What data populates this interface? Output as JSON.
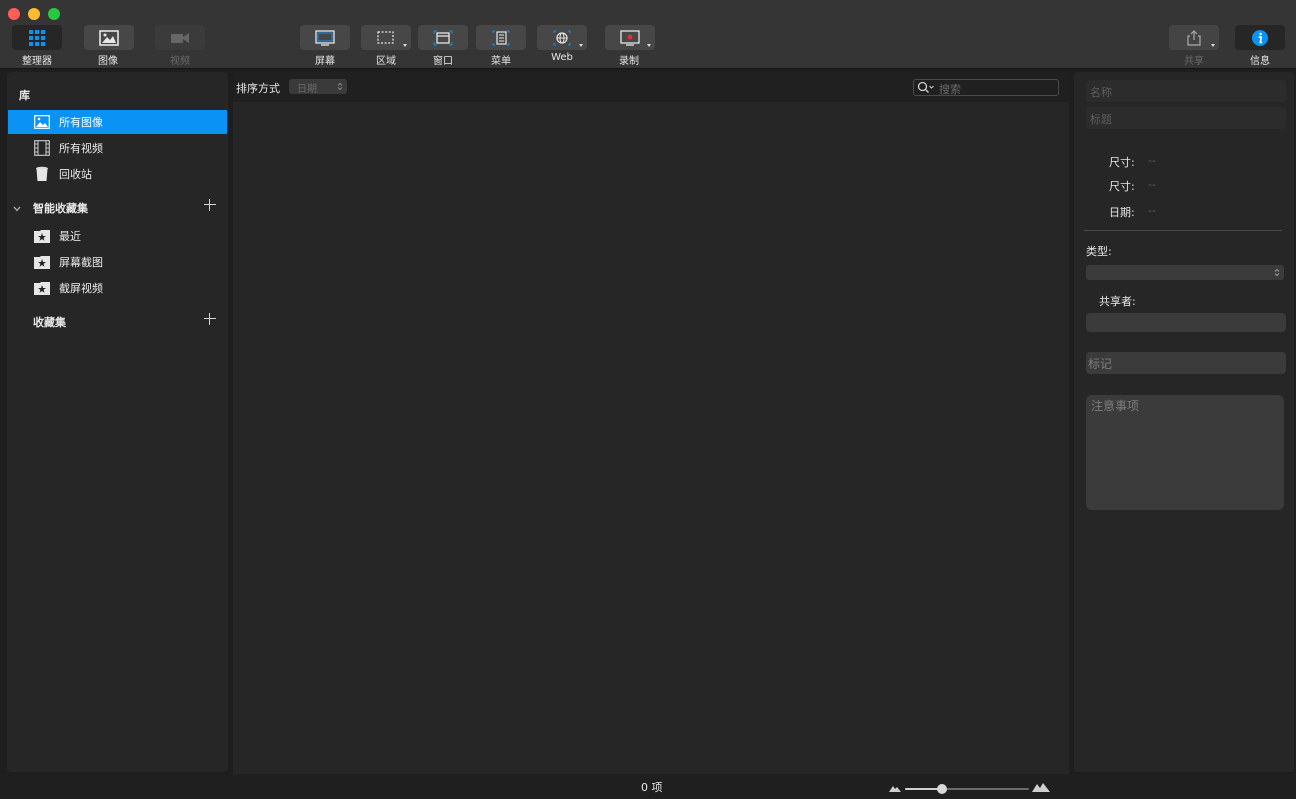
{
  "toolbar": {
    "left_buttons": [
      {
        "id": "organizer",
        "label": "整理器",
        "state": "active"
      },
      {
        "id": "images",
        "label": "图像",
        "state": "normal"
      },
      {
        "id": "video",
        "label": "视频",
        "state": "disabled"
      }
    ],
    "capture_buttons": [
      {
        "id": "screen",
        "label": "屏幕"
      },
      {
        "id": "region",
        "label": "区域"
      },
      {
        "id": "window",
        "label": "窗口"
      },
      {
        "id": "menu",
        "label": "菜单"
      },
      {
        "id": "web",
        "label": "Web"
      },
      {
        "id": "record",
        "label": "录制"
      }
    ],
    "share_label": "共享",
    "info_label": "信息"
  },
  "sidebar": {
    "library_header": "库",
    "library_items": [
      {
        "label": "所有图像",
        "icon": "image-icon",
        "selected": true
      },
      {
        "label": "所有视频",
        "icon": "film-icon",
        "selected": false
      },
      {
        "label": "回收站",
        "icon": "trash-icon",
        "selected": false
      }
    ],
    "smart_header": "智能收藏集",
    "smart_items": [
      {
        "label": "最近",
        "icon": "star-folder-icon"
      },
      {
        "label": "屏幕截图",
        "icon": "star-folder-icon"
      },
      {
        "label": "截屏视频",
        "icon": "star-folder-icon"
      }
    ],
    "collections_header": "收藏集"
  },
  "main": {
    "sort_label": "排序方式",
    "sort_value": "日期",
    "search_placeholder": "搜索"
  },
  "info_panel": {
    "name_placeholder": "名称",
    "title_placeholder": "标题",
    "rows": [
      {
        "label": "尺寸:",
        "value": "--"
      },
      {
        "label": "尺寸:",
        "value": "--"
      },
      {
        "label": "日期:",
        "value": "--"
      }
    ],
    "type_label": "类型:",
    "type_value": "",
    "shared_label": "共享者:",
    "tags_placeholder": "标记",
    "notes_placeholder": "注意事项"
  },
  "status": {
    "count": "0 项",
    "zoom_level": 0.3
  },
  "colors": {
    "accent": "#0a93f5",
    "close": "#ff5f57",
    "minimize": "#febc2e",
    "zoom": "#28c840",
    "record": "#e0303a"
  }
}
